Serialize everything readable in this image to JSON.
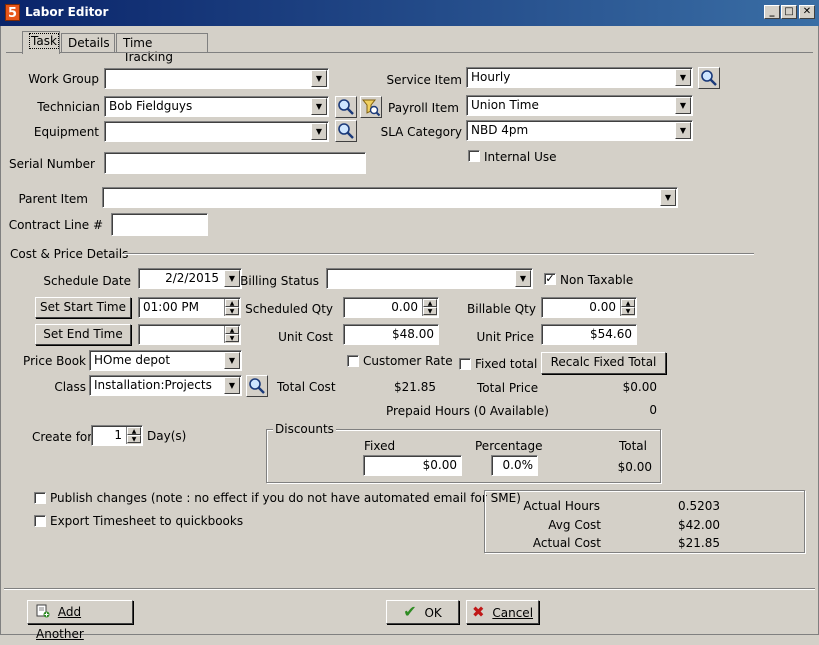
{
  "window": {
    "title": "Labor Editor",
    "app_icon": "5",
    "min": "_",
    "max": "□",
    "close": "✕"
  },
  "tabs": [
    {
      "label": "Task"
    },
    {
      "label": "Details"
    },
    {
      "label": "Time Tracking"
    }
  ],
  "task": {
    "work_group": {
      "label": "Work Group",
      "value": ""
    },
    "technician": {
      "label": "Technician",
      "value": "Bob Fieldguys"
    },
    "equipment": {
      "label": "Equipment",
      "value": ""
    },
    "serial_number": {
      "label": "Serial Number",
      "value": ""
    },
    "parent_item": {
      "label": "Parent Item",
      "value": ""
    },
    "contract_line": {
      "label": "Contract Line #",
      "value": ""
    },
    "service_item": {
      "label": "Service Item",
      "value": "Hourly"
    },
    "payroll_item": {
      "label": "Payroll Item",
      "value": "Union Time"
    },
    "sla_category": {
      "label": "SLA Category",
      "value": "NBD 4pm"
    },
    "internal_use": {
      "label": "Internal Use",
      "checked": false
    }
  },
  "cost": {
    "section_title": "Cost & Price Details",
    "schedule_date": {
      "label": "Schedule Date",
      "value": "2/2/2015"
    },
    "billing_status": {
      "label": "Billing Status",
      "value": ""
    },
    "non_taxable": {
      "label": "Non Taxable",
      "checked": true
    },
    "set_start_time": "Set Start Time",
    "start_time": "01:00 PM",
    "set_end_time": "Set End Time",
    "end_time": "",
    "scheduled_qty": {
      "label": "Scheduled Qty",
      "value": "0.00"
    },
    "billable_qty": {
      "label": "Billable Qty",
      "value": "0.00"
    },
    "unit_cost": {
      "label": "Unit Cost",
      "value": "$48.00"
    },
    "unit_price": {
      "label": "Unit Price",
      "value": "$54.60"
    },
    "price_book": {
      "label": "Price Book",
      "value": "HOme depot"
    },
    "customer_rate": {
      "label": "Customer Rate",
      "checked": false
    },
    "fixed_total": {
      "label": "Fixed total",
      "checked": false
    },
    "recalc_fixed_total": "Recalc Fixed Total",
    "class": {
      "label": "Class",
      "value": "Installation:Projects"
    },
    "total_cost": {
      "label": "Total Cost",
      "value": "$21.85"
    },
    "total_price": {
      "label": "Total Price",
      "value": "$0.00"
    },
    "prepaid_hours": {
      "label": "Prepaid Hours (0 Available)",
      "value": "0"
    },
    "create_for": {
      "label": "Create for",
      "value": "1",
      "unit": "Day(s)"
    }
  },
  "discounts": {
    "title": "Discounts",
    "fixed_label": "Fixed",
    "fixed_value": "$0.00",
    "percentage_label": "Percentage",
    "percentage_value": "0.0%",
    "total_label": "Total",
    "total_value": "$0.00"
  },
  "options": {
    "publish_changes": {
      "label": "Publish changes (note : no effect if you do not have automated email for SME)",
      "checked": false
    },
    "export_timesheet": {
      "label": "Export Timesheet to quickbooks",
      "checked": false
    }
  },
  "actuals": {
    "actual_hours": {
      "label": "Actual Hours",
      "value": "0.5203"
    },
    "avg_cost": {
      "label": "Avg Cost",
      "value": "$42.00"
    },
    "actual_cost": {
      "label": "Actual Cost",
      "value": "$21.85"
    }
  },
  "footer": {
    "add_another": "Add Another",
    "ok": "OK",
    "cancel": "Cancel"
  },
  "colors": {
    "titlebar": "#0a246a",
    "face": "#d4d0c8",
    "ok_check": "#2e8b22",
    "cancel_x": "#c01818"
  }
}
